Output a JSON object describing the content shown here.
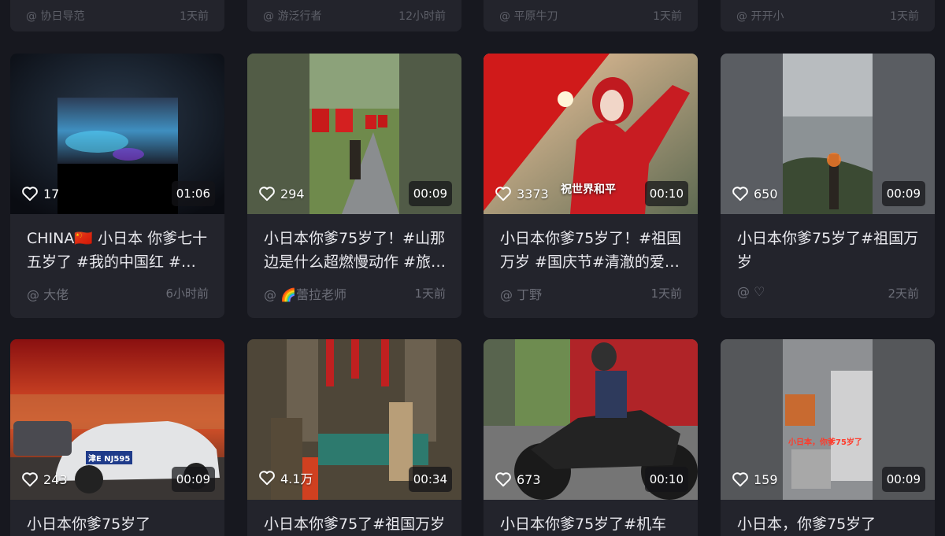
{
  "top_row": [
    {
      "author": "@ 协日导范",
      "time": "1天前"
    },
    {
      "author": "@ 游泛行者",
      "time": "12小时前"
    },
    {
      "author": "@ 平原牛刀",
      "time": "1天前"
    },
    {
      "author": "@ 开开小",
      "time": "1天前"
    }
  ],
  "videos": [
    {
      "likes": "17",
      "duration": "01:06",
      "title": "CHINA🇨🇳 小日本 你爹七十五岁了 #我的中国红 #旅…",
      "author": "@ 大佬",
      "time": "6小时前"
    },
    {
      "likes": "294",
      "duration": "00:09",
      "title": "小日本你爹75岁了！#山那边是什么超燃慢动作 #旅…",
      "author": "@ 🌈蕾拉老师",
      "time": "1天前"
    },
    {
      "likes": "3373",
      "duration": "00:10",
      "title": "小日本你爹75岁了！#祖国万岁 #国庆节#清澈的爱…",
      "author": "@ 丁野",
      "time": "1天前",
      "overlay": "祝世界和平"
    },
    {
      "likes": "650",
      "duration": "00:09",
      "title": "小日本你爹75岁了#祖国万岁",
      "author": "@ ♡",
      "time": "2天前"
    },
    {
      "likes": "243",
      "duration": "00:09",
      "title": "小日本你爹75岁了",
      "plate": "津E NJ595"
    },
    {
      "likes": "4.1万",
      "duration": "00:34",
      "title": "小日本你爹75了#祖国万岁"
    },
    {
      "likes": "673",
      "duration": "00:10",
      "title": "小日本你爹75岁了#机车 #"
    },
    {
      "likes": "159",
      "duration": "00:09",
      "title": "小日本，你爹75岁了",
      "overlay": "小日本，你爹75岁了"
    }
  ],
  "colors": {
    "background": "#17181f",
    "card": "#23242c",
    "muted": "#6b6d77"
  },
  "icons": {
    "like": "heart-outline-icon"
  }
}
